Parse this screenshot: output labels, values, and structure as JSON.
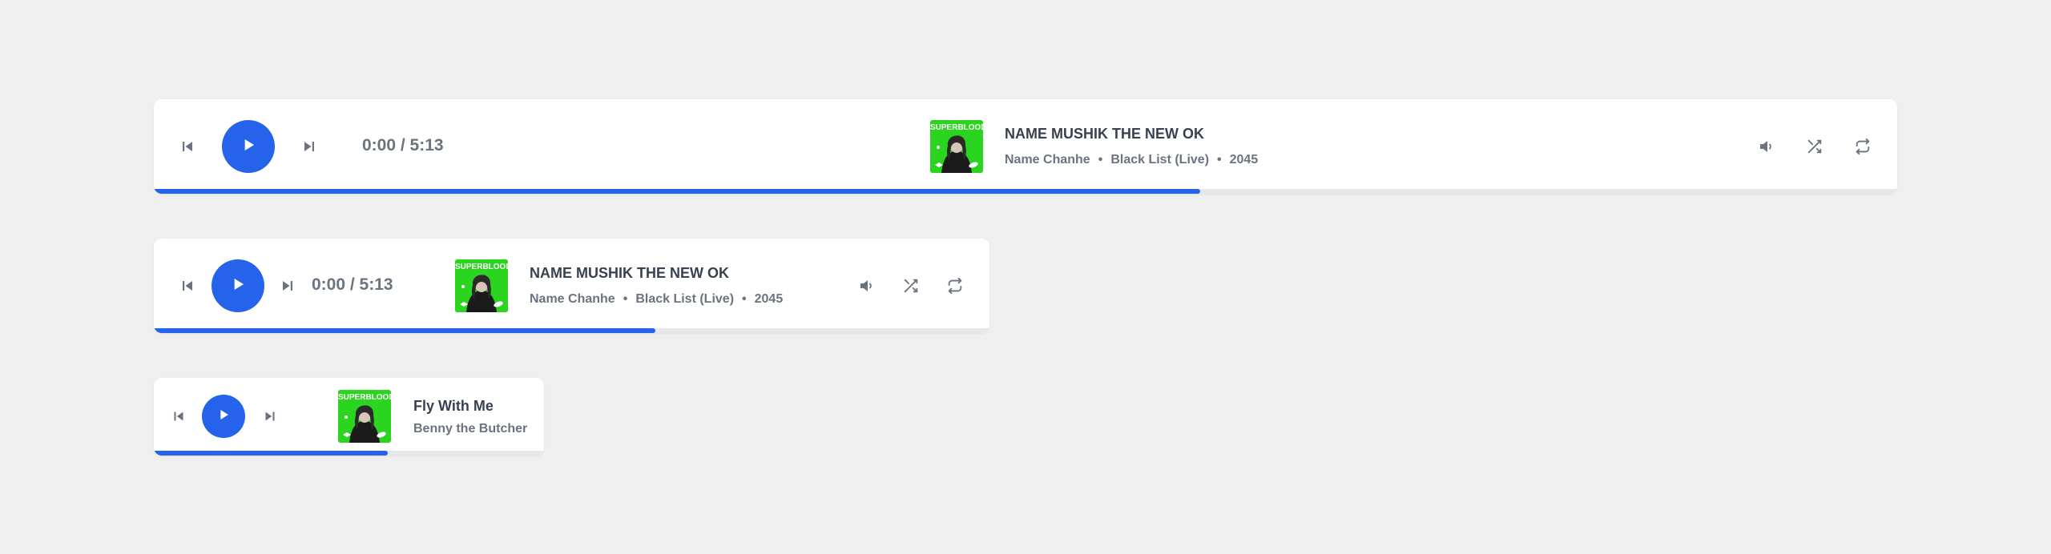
{
  "colors": {
    "accent": "#2563eb",
    "background": "#efefef",
    "cover_green": "#2bd51f"
  },
  "icons": {
    "previous": "skip-previous-icon",
    "play": "play-icon",
    "next": "skip-next-icon",
    "volume": "volume-icon",
    "shuffle": "shuffle-icon",
    "repeat": "repeat-icon"
  },
  "player_large": {
    "time": "0:00 / 5:13",
    "cover_text": "SUPERBLOOD",
    "title": "NAME MUSHIK THE NEW OK",
    "artist": "Name Chanhe",
    "album": "Black List (Live)",
    "year": "2045",
    "progress": 0.6
  },
  "player_medium": {
    "time": "0:00 / 5:13",
    "cover_text": "SUPERBLOOD",
    "title": "NAME MUSHIK THE NEW OK",
    "artist": "Name Chanhe",
    "album": "Black List (Live)",
    "year": "2045",
    "progress": 0.6
  },
  "player_small": {
    "cover_text": "SUPERBLOOD",
    "title": "Fly With Me",
    "artist": "Benny the Butcher",
    "progress": 0.6
  }
}
